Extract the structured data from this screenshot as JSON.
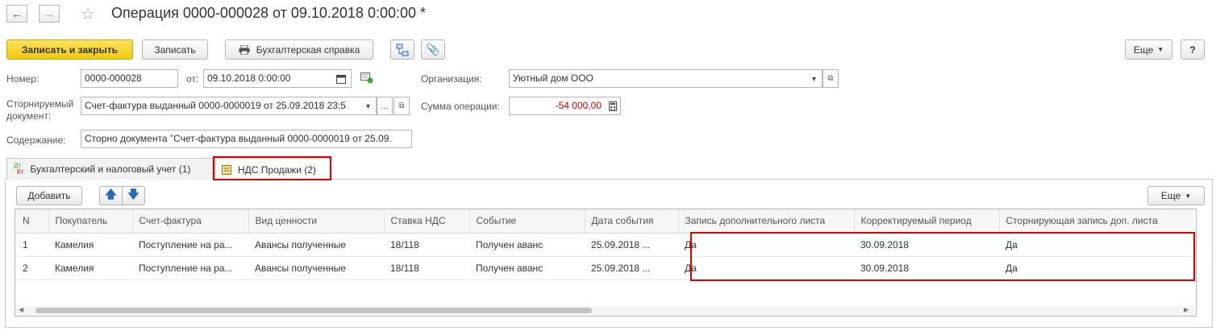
{
  "header": {
    "title": "Операция 0000-000028 от 09.10.2018 0:00:00 *",
    "back_icon": "arrow-left-icon",
    "forward_icon": "arrow-right-icon",
    "favorite_icon": "star-icon"
  },
  "toolbar": {
    "save_close_label": "Записать и закрыть",
    "save_label": "Записать",
    "report_label": "Бухгалтерская справка",
    "more_label": "Еще",
    "help_label": "?"
  },
  "form": {
    "number_label": "Номер:",
    "number_value": "0000-000028",
    "date_label": "от:",
    "date_value": "09.10.2018  0:00:00",
    "org_label": "Организация:",
    "org_value": "Уютный дом ООО",
    "storno_label_1": "Сторнируемый",
    "storno_label_2": "документ:",
    "storno_value": "Счет-фактура выданный 0000-0000019 от 25.09.2018 23:5",
    "sum_label": "Сумма операции:",
    "sum_value": "-54 000,00",
    "content_label": "Содержание:",
    "content_value": "Сторно документа \"Счет-фактура выданный 0000-0000019 от 25.09."
  },
  "tabs": [
    {
      "label": "Бухгалтерский и налоговый учет (1)",
      "icon": "dt-kt-icon"
    },
    {
      "label": "НДС Продажи (2)",
      "icon": "document-icon"
    }
  ],
  "table_toolbar": {
    "add_label": "Добавить",
    "more_label": "Еще"
  },
  "table": {
    "columns": [
      "N",
      "Покупатель",
      "Счет-фактура",
      "Вид ценности",
      "Ставка НДС",
      "Событие",
      "Дата события",
      "Запись дополнительного листа",
      "Корректируемый период",
      "Сторнирующая запись доп. листа"
    ],
    "rows": [
      [
        "1",
        "Камелия",
        "Поступление на ра...",
        "Авансы полученные",
        "18/118",
        "Получен аванс",
        "25.09.2018 ...",
        "Да",
        "30.09.2018",
        "Да"
      ],
      [
        "2",
        "Камелия",
        "Поступление на ра...",
        "Авансы полученные",
        "18/118",
        "Получен аванс",
        "25.09.2018 ...",
        "Да",
        "30.09.2018",
        "Да"
      ]
    ]
  },
  "colors": {
    "primary_button": "#f2c811",
    "highlight": "#e00000",
    "negative_sum": "#cc0000"
  }
}
